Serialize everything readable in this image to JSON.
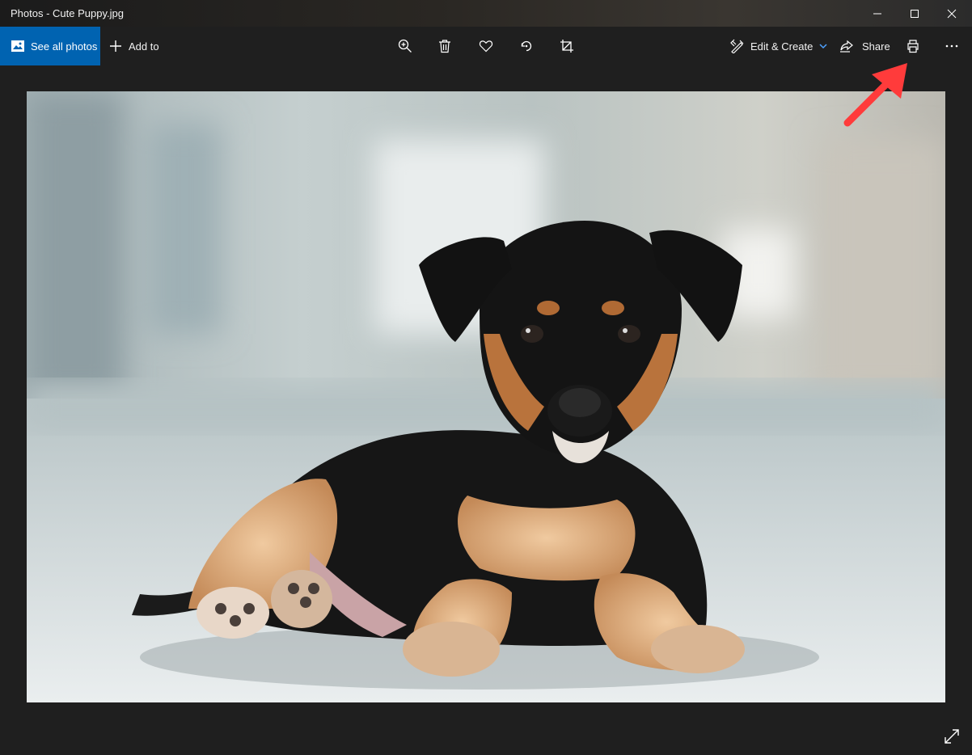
{
  "window": {
    "title": "Photos - Cute Puppy.jpg",
    "controls": {
      "minimize": "minimize-icon",
      "maximize": "maximize-icon",
      "close": "close-icon"
    }
  },
  "toolbar": {
    "see_all_photos": "See all photos",
    "add_to": "Add to",
    "center_icons": [
      "zoom-in-icon",
      "delete-icon",
      "favorite-icon",
      "rotate-icon",
      "crop-icon"
    ],
    "edit_create": "Edit & Create",
    "share": "Share",
    "print_icon": "print-icon",
    "more": "more-options-icon"
  },
  "viewer": {
    "image": "Cute Puppy.jpg",
    "fullscreen_icon": "expand-icon"
  },
  "annotation": {
    "arrow_color": "#ff3b3b",
    "points_to": "print-button"
  },
  "colors": {
    "accent": "#0063b1",
    "background": "#1f1f1f"
  }
}
